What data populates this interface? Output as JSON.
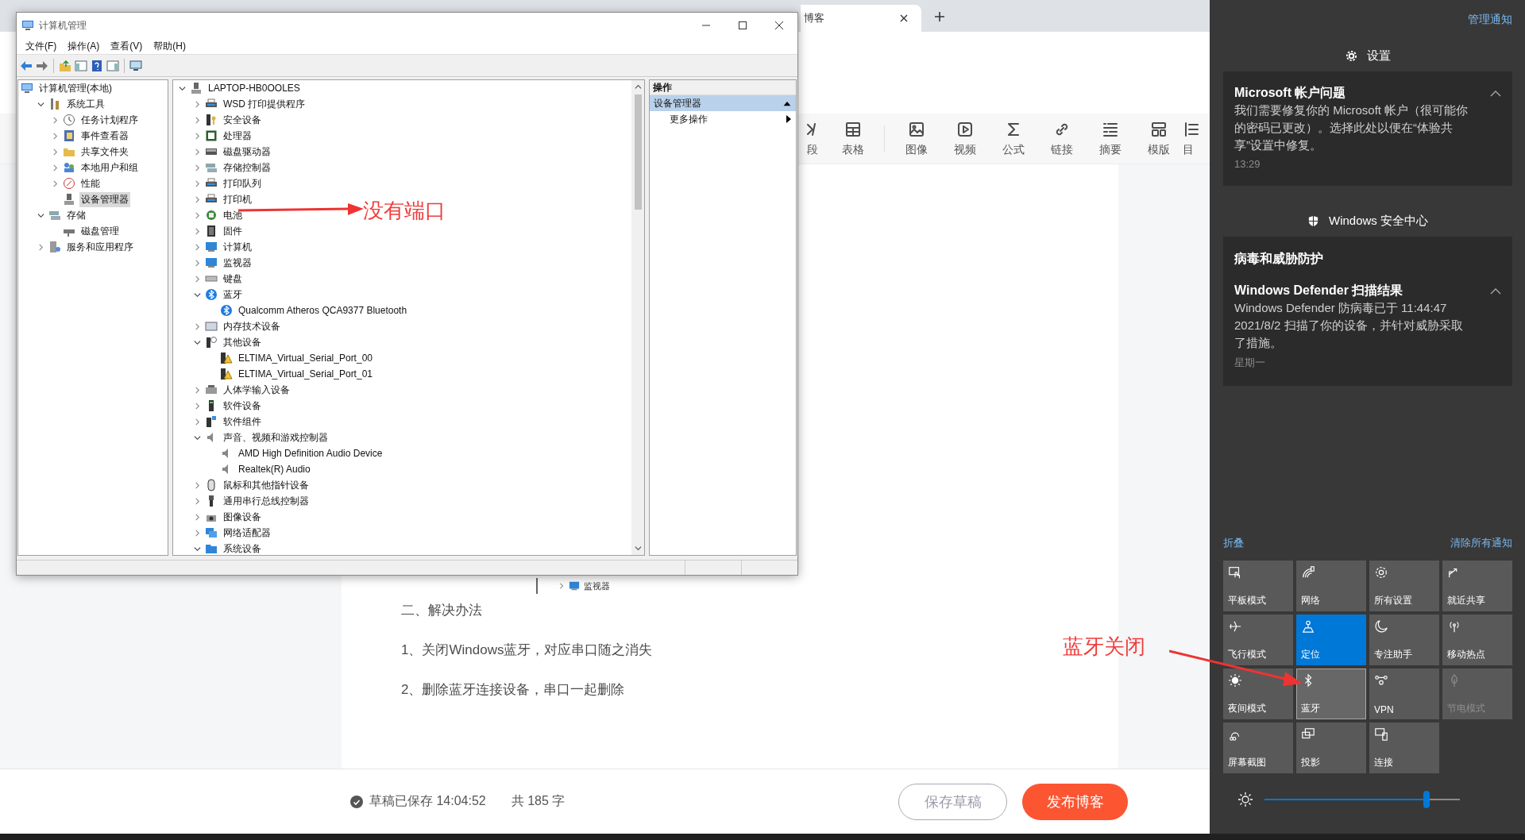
{
  "browser": {
    "tab": {
      "title": "博客"
    }
  },
  "computer_management": {
    "title": "计算机管理",
    "menu": [
      "文件(F)",
      "操作(A)",
      "查看(V)",
      "帮助(H)"
    ],
    "toolbar": [
      {
        "kind": "back"
      },
      {
        "kind": "forward"
      },
      {
        "kind": "up"
      },
      {
        "kind": "tree"
      },
      {
        "kind": "help"
      },
      {
        "kind": "pane"
      },
      {
        "kind": "monitor"
      }
    ],
    "nav_tree": [
      {
        "label": "计算机管理(本地)",
        "kind": "computer",
        "selected": false,
        "children": [
          {
            "label": "系统工具",
            "kind": "tools",
            "expanded": true,
            "selected": false,
            "children": [
              {
                "label": "任务计划程序",
                "kind": "clock",
                "expanded": false,
                "selected": false
              },
              {
                "label": "事件查看器",
                "kind": "log",
                "expanded": false,
                "selected": false
              },
              {
                "label": "共享文件夹",
                "kind": "folder",
                "expanded": false,
                "selected": false
              },
              {
                "label": "本地用户和组",
                "kind": "users",
                "expanded": false,
                "selected": false
              },
              {
                "label": "性能",
                "kind": "perf",
                "expanded": false,
                "selected": false
              },
              {
                "label": "设备管理器",
                "kind": "devmgr",
                "selected": true
              }
            ]
          },
          {
            "label": "存储",
            "kind": "storage",
            "expanded": true,
            "selected": false,
            "children": [
              {
                "label": "磁盘管理",
                "kind": "disk",
                "selected": false
              }
            ]
          },
          {
            "label": "服务和应用程序",
            "kind": "services",
            "expanded": false,
            "selected": false
          }
        ]
      }
    ],
    "device_tree": [
      {
        "label": "LAPTOP-HB0OOLES",
        "kind": "devmgr",
        "expanded": true,
        "children": [
          {
            "label": "WSD 打印提供程序",
            "kind": "printer",
            "expanded": false
          },
          {
            "label": "安全设备",
            "kind": "security",
            "expanded": false
          },
          {
            "label": "处理器",
            "kind": "chip",
            "expanded": false
          },
          {
            "label": "磁盘驱动器",
            "kind": "drive",
            "expanded": false
          },
          {
            "label": "存储控制器",
            "kind": "storage",
            "expanded": false
          },
          {
            "label": "打印队列",
            "kind": "printer",
            "expanded": false
          },
          {
            "label": "打印机",
            "kind": "printer",
            "expanded": false
          },
          {
            "label": "电池",
            "kind": "battery",
            "expanded": false
          },
          {
            "label": "固件",
            "kind": "firmware",
            "expanded": false
          },
          {
            "label": "计算机",
            "kind": "monitor",
            "expanded": false
          },
          {
            "label": "监视器",
            "kind": "monitor",
            "expanded": false
          },
          {
            "label": "键盘",
            "kind": "keyboard",
            "expanded": false
          },
          {
            "label": "蓝牙",
            "kind": "bluetooth",
            "expanded": true,
            "children": [
              {
                "label": "Qualcomm Atheros QCA9377 Bluetooth",
                "kind": "bluetooth"
              }
            ]
          },
          {
            "label": "内存技术设备",
            "kind": "memory",
            "expanded": false
          },
          {
            "label": "其他设备",
            "kind": "other",
            "expanded": true,
            "children": [
              {
                "label": "ELTIMA_Virtual_Serial_Port_00",
                "kind": "warning"
              },
              {
                "label": "ELTIMA_Virtual_Serial_Port_01",
                "kind": "warning"
              }
            ]
          },
          {
            "label": "人体学输入设备",
            "kind": "hid",
            "expanded": false
          },
          {
            "label": "软件设备",
            "kind": "software",
            "expanded": false
          },
          {
            "label": "软件组件",
            "kind": "component",
            "expanded": false
          },
          {
            "label": "声音、视频和游戏控制器",
            "kind": "speaker",
            "expanded": true,
            "children": [
              {
                "label": "AMD High Definition Audio Device",
                "kind": "speaker"
              },
              {
                "label": "Realtek(R) Audio",
                "kind": "speaker"
              }
            ]
          },
          {
            "label": "鼠标和其他指针设备",
            "kind": "mouse",
            "expanded": false
          },
          {
            "label": "通用串行总线控制器",
            "kind": "usb",
            "expanded": false
          },
          {
            "label": "图像设备",
            "kind": "camera",
            "expanded": false
          },
          {
            "label": "网络适配器",
            "kind": "network",
            "expanded": false
          },
          {
            "label": "系统设备",
            "kind": "system",
            "expanded": true
          }
        ]
      }
    ],
    "actions": {
      "header": "操作",
      "sections": [
        {
          "label": "设备管理器",
          "expanded": true,
          "items": [
            "更多操作"
          ]
        }
      ]
    }
  },
  "editor": {
    "toolbar_groups": [
      [
        {
          "label": "段",
          "kind": "code"
        },
        {
          "label": "表格",
          "kind": "table"
        }
      ],
      [
        {
          "label": "图像",
          "kind": "image"
        },
        {
          "label": "视频",
          "kind": "video"
        },
        {
          "label": "公式",
          "kind": "formula"
        },
        {
          "label": "链接",
          "kind": "link"
        },
        {
          "label": "摘要",
          "kind": "summary"
        },
        {
          "label": "模版",
          "kind": "template"
        },
        {
          "label": "目",
          "kind": "toc"
        }
      ]
    ],
    "embedded_item": "监视器",
    "paragraphs": [
      "二、解决办法",
      "1、关闭Windows蓝牙，对应串口随之消失",
      "2、删除蓝牙连接设备，串口一起删除"
    ],
    "saved": "草稿已保存 14:04:52",
    "count": "共 185 字",
    "buttons": [
      {
        "label": "保存草稿",
        "kind": "secondary"
      },
      {
        "label": "发布博客",
        "kind": "primary"
      }
    ]
  },
  "action_center": {
    "manage": "管理通知",
    "groups": [
      {
        "app": "设置",
        "kind": "gear",
        "notifications": [
          {
            "title": "Microsoft 帐户问题",
            "body": "我们需要修复你的 Microsoft 帐户（很可能你的密码已更改）。选择此处以便在“体验共享”设置中修复。",
            "time": "13:29"
          }
        ]
      },
      {
        "app": "Windows 安全中心",
        "kind": "shield",
        "header": "病毒和威胁防护",
        "notifications": [
          {
            "title": "Windows Defender 扫描结果",
            "body": "Windows Defender 防病毒已于 11:44:47 2021/8/2 扫描了你的设备，并针对威胁采取了措施。",
            "time": "星期一"
          }
        ]
      }
    ],
    "collapse": "折叠",
    "clear": "清除所有通知",
    "tiles": [
      {
        "label": "平板模式",
        "kind": "tablet",
        "on": false,
        "disabled": false,
        "hovered": false
      },
      {
        "label": "网络",
        "kind": "network",
        "on": false,
        "disabled": false,
        "hovered": false
      },
      {
        "label": "所有设置",
        "kind": "gear",
        "on": false,
        "disabled": false,
        "hovered": false
      },
      {
        "label": "就近共享",
        "kind": "share",
        "on": false,
        "disabled": false,
        "hovered": false
      },
      {
        "label": "飞行模式",
        "kind": "airplane",
        "on": false,
        "disabled": false,
        "hovered": false
      },
      {
        "label": "定位",
        "kind": "location",
        "on": true,
        "disabled": false,
        "hovered": false
      },
      {
        "label": "专注助手",
        "kind": "moon",
        "on": false,
        "disabled": false,
        "hovered": false
      },
      {
        "label": "移动热点",
        "kind": "hotspot",
        "on": false,
        "disabled": false,
        "hovered": false
      },
      {
        "label": "夜间模式",
        "kind": "sun",
        "on": false,
        "disabled": false,
        "hovered": false
      },
      {
        "label": "蓝牙",
        "kind": "bluetooth",
        "on": false,
        "disabled": false,
        "hovered": true
      },
      {
        "label": "VPN",
        "kind": "vpn",
        "on": false,
        "disabled": false,
        "hovered": false
      },
      {
        "label": "节电模式",
        "kind": "leaf",
        "on": false,
        "disabled": true,
        "hovered": false
      },
      {
        "label": "屏幕截图",
        "kind": "snip",
        "on": false,
        "disabled": false,
        "hovered": false
      },
      {
        "label": "投影",
        "kind": "project",
        "on": false,
        "disabled": false,
        "hovered": false
      },
      {
        "label": "连接",
        "kind": "connect",
        "on": false,
        "disabled": false,
        "hovered": false
      }
    ],
    "brightness": {
      "level": 0.83
    }
  },
  "annotations": [
    {
      "text": "没有端口"
    },
    {
      "text": "蓝牙关闭"
    }
  ]
}
